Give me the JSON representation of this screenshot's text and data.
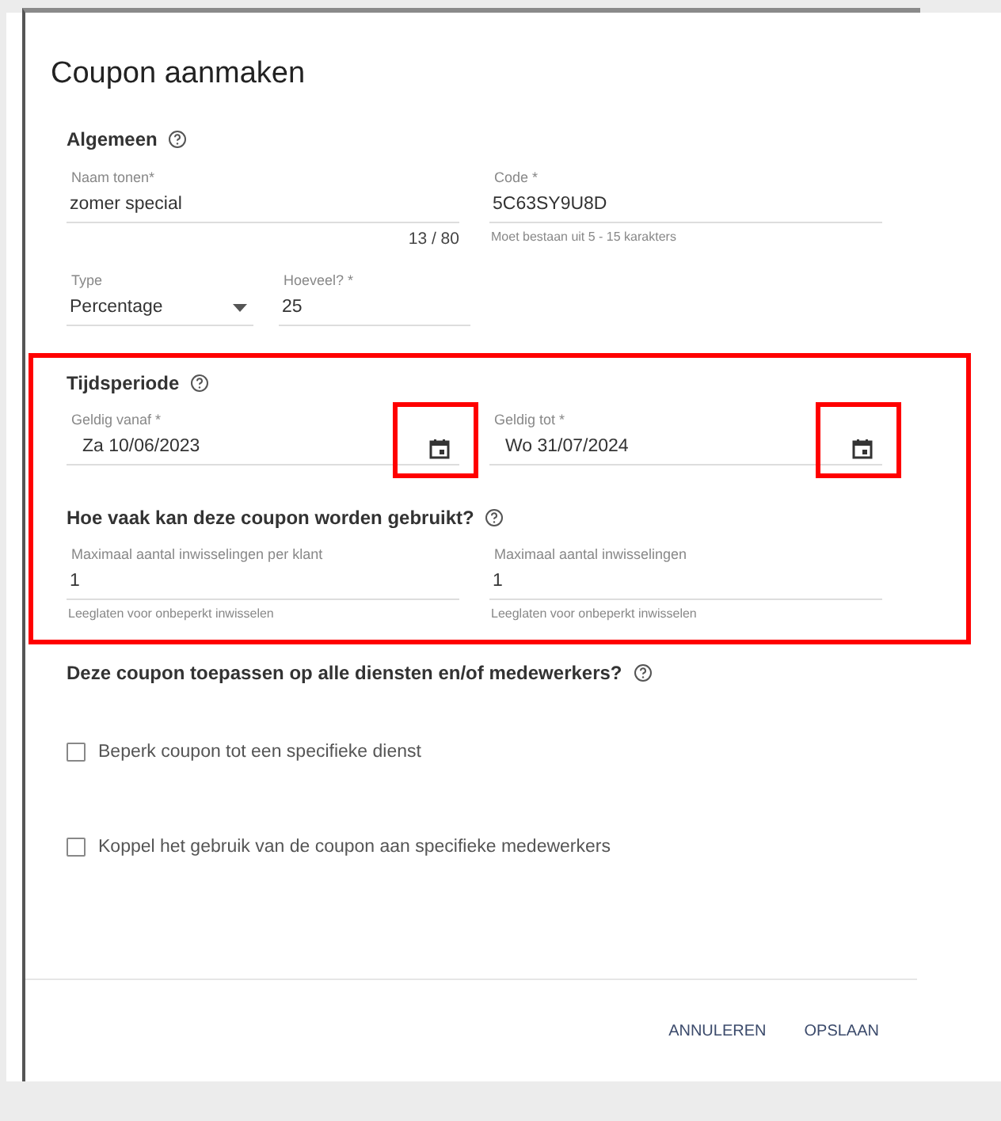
{
  "dialog": {
    "title": "Coupon aanmaken"
  },
  "general": {
    "heading": "Algemeen",
    "name": {
      "label": "Naam tonen*",
      "value": "zomer special",
      "counter": "13 / 80"
    },
    "code": {
      "label": "Code *",
      "value": "5C63SY9U8D",
      "helper": "Moet bestaan uit 5 - 15 karakters"
    },
    "type": {
      "label": "Type",
      "value": "Percentage"
    },
    "amount": {
      "label": "Hoeveel? *",
      "value": "25"
    }
  },
  "period": {
    "highlighted": true,
    "heading": "Tijdsperiode",
    "dates": [
      {
        "label": "Geldig vanaf *",
        "value": "Za 10/06/2023",
        "highlighted": true
      },
      {
        "label": "Geldig tot *",
        "value": "Wo 31/07/2024",
        "highlighted": true
      }
    ],
    "usage_heading": "Hoe vaak kan deze coupon worden gebruikt?",
    "usage": [
      {
        "label": "Maximaal aantal inwisselingen per klant",
        "value": "1",
        "helper": "Leeglaten voor onbeperkt inwisselen"
      },
      {
        "label": "Maximaal aantal inwisselingen",
        "value": "1",
        "helper": "Leeglaten voor onbeperkt inwisselen"
      }
    ]
  },
  "apply": {
    "heading": "Deze coupon toepassen op alle diensten en/of medewerkers?",
    "options": [
      {
        "label": "Beperk coupon tot een specifieke dienst",
        "checked": false
      },
      {
        "label": "Koppel het gebruik van de coupon aan specifieke medewerkers",
        "checked": false
      }
    ]
  },
  "buttons": [
    "ANNULEREN",
    "OPSLAAN"
  ]
}
